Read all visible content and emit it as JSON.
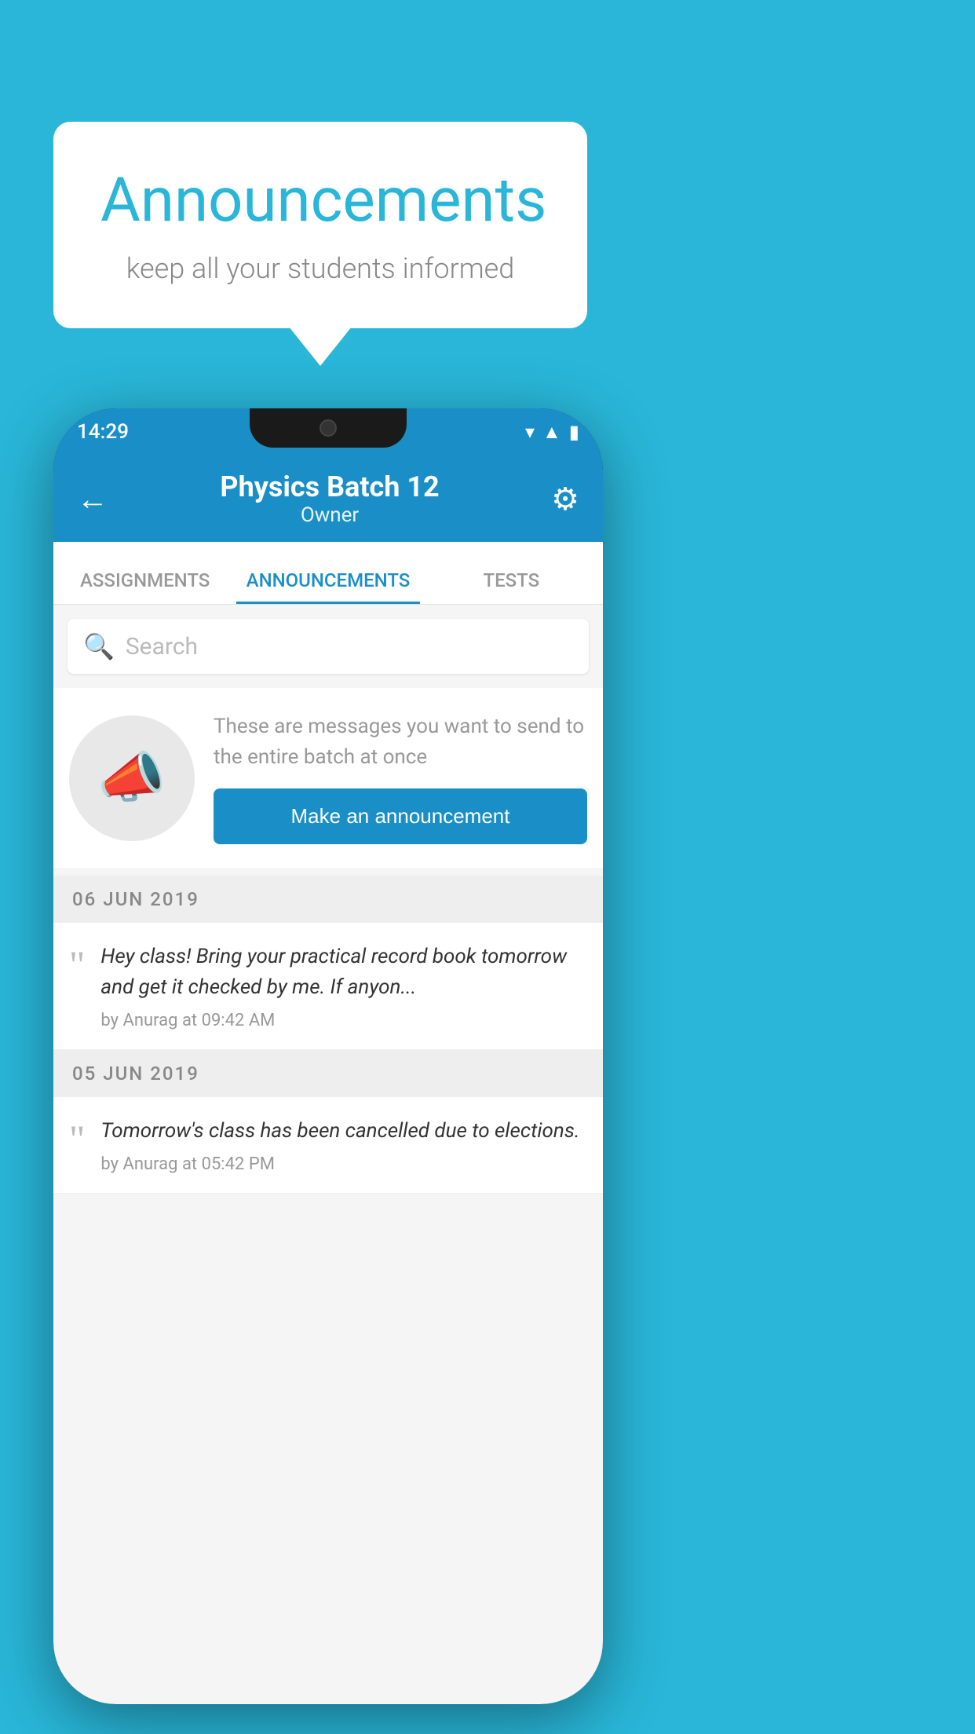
{
  "background_color": "#29b6d8",
  "speech_bubble": {
    "title": "Announcements",
    "subtitle": "keep all your students informed"
  },
  "phone": {
    "status_bar": {
      "time": "14:29"
    },
    "header": {
      "title": "Physics Batch 12",
      "subtitle": "Owner",
      "back_label": "←",
      "settings_label": "⚙"
    },
    "tabs": [
      {
        "label": "ASSIGNMENTS",
        "active": false
      },
      {
        "label": "ANNOUNCEMENTS",
        "active": true
      },
      {
        "label": "TESTS",
        "active": false
      }
    ],
    "search": {
      "placeholder": "Search"
    },
    "promo": {
      "description": "These are messages you want to send to the entire batch at once",
      "button_label": "Make an announcement"
    },
    "announcements": [
      {
        "date": "06  JUN  2019",
        "text": "Hey class! Bring your practical record book tomorrow and get it checked by me. If anyon...",
        "meta": "by Anurag at 09:42 AM"
      },
      {
        "date": "05  JUN  2019",
        "text": "Tomorrow's class has been cancelled due to elections.",
        "meta": "by Anurag at 05:42 PM"
      }
    ]
  }
}
